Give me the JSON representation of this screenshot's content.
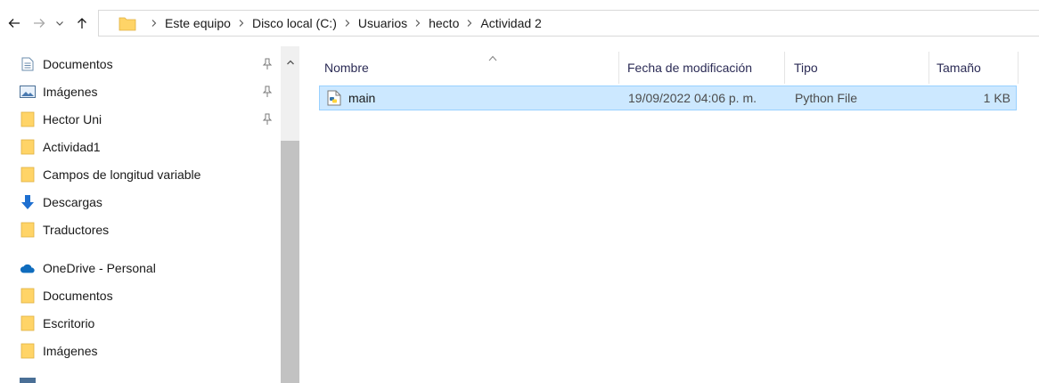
{
  "breadcrumb": [
    "Este equipo",
    "Disco local (C:)",
    "Usuarios",
    "hecto",
    "Actividad 2"
  ],
  "nav": {
    "quick_access": [
      {
        "label": "Documentos",
        "icon": "documents-icon",
        "pinned": true
      },
      {
        "label": "Imágenes",
        "icon": "pictures-icon",
        "pinned": true
      },
      {
        "label": "Hector Uni",
        "icon": "folder-icon",
        "pinned": true
      },
      {
        "label": "Actividad1",
        "icon": "folder-icon",
        "pinned": false
      },
      {
        "label": "Campos de longitud variable",
        "icon": "folder-icon",
        "pinned": false
      },
      {
        "label": "Descargas",
        "icon": "downloads-icon",
        "pinned": false
      },
      {
        "label": "Traductores",
        "icon": "folder-icon",
        "pinned": false
      }
    ],
    "onedrive": {
      "label": "OneDrive - Personal",
      "icon": "onedrive-cloud-icon",
      "items": [
        {
          "label": "Documentos",
          "icon": "folder-icon"
        },
        {
          "label": "Escritorio",
          "icon": "folder-icon"
        },
        {
          "label": "Imágenes",
          "icon": "folder-icon"
        }
      ]
    }
  },
  "columns": {
    "name": "Nombre",
    "date": "Fecha de modificación",
    "type": "Tipo",
    "size": "Tamaño"
  },
  "files": [
    {
      "name": "main",
      "date": "19/09/2022 04:06 p. m.",
      "type": "Python File",
      "size": "1 KB",
      "icon": "python-file-icon",
      "selected": true
    }
  ],
  "colors": {
    "selection_bg": "#cce8ff",
    "selection_border": "#99d1ff",
    "folder_yellow": "#ffd467",
    "accent_blue": "#1e6fd0"
  }
}
